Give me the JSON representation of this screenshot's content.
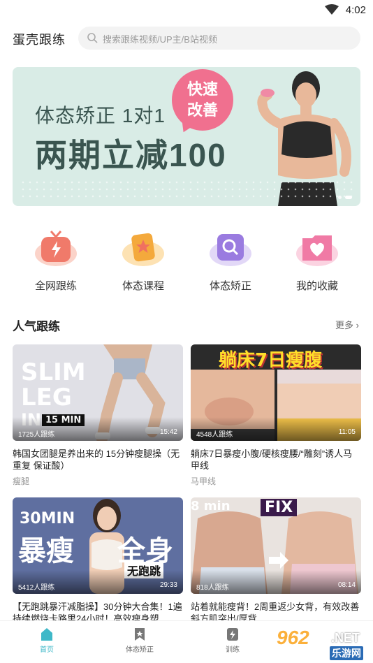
{
  "status_bar": {
    "time": "4:02"
  },
  "header": {
    "app_title": "蛋壳跟练",
    "search_placeholder": "搜索跟练视频/UP主/B站视频"
  },
  "banner": {
    "line1": "体态矫正 1对1",
    "line2": "两期立减100",
    "badge": [
      "快速",
      "改善"
    ]
  },
  "quick_nav": [
    {
      "label": "全网跟练",
      "icon": "lightning-tv-icon",
      "color": "#f07a6a"
    },
    {
      "label": "体态课程",
      "icon": "star-card-icon",
      "color": "#f4a93c"
    },
    {
      "label": "体态矫正",
      "icon": "search-screen-icon",
      "color": "#9a7be0"
    },
    {
      "label": "我的收藏",
      "icon": "heart-folder-icon",
      "color": "#f07aa5"
    }
  ],
  "section": {
    "title": "人气跟练",
    "more": "更多"
  },
  "videos": [
    {
      "title": "韩国女团腿是养出来的 15分钟瘦腿操（无重复 保证酸）",
      "tag": "瘦腿",
      "views": "1725人跟练",
      "duration": "15:42",
      "thumb_text": [
        "SLIM",
        "LEG",
        "IN",
        "15 MIN"
      ]
    },
    {
      "title": "躺床7日暴瘦小腹/硬核瘦腰/“雕刻”诱人马甲线",
      "tag": "马甲线",
      "views": "4548人跟练",
      "duration": "11:05",
      "thumb_text": [
        "躺床7日瘦腹"
      ]
    },
    {
      "title": "【无跑跳暴汗减脂操】30分钟大合集！1遍持续燃烧卡路里24小时！高效瘦身塑",
      "tag": "",
      "views": "5412人跟练",
      "duration": "29:33",
      "thumb_text": [
        "30MIN",
        "暴瘦",
        "全身",
        "无跑跳"
      ]
    },
    {
      "title": "站着就能瘦背！2周重返少女背，有效改善斜方肌突出/厚背",
      "tag": "",
      "views": "818人跟练",
      "duration": "08:14",
      "thumb_text": [
        "8 min",
        "FIX"
      ]
    }
  ],
  "bottom_nav": [
    {
      "label": "首页",
      "icon": "home-icon",
      "active": true
    },
    {
      "label": "体态矫正",
      "icon": "bookmark-icon",
      "active": false
    },
    {
      "label": "训练",
      "icon": "lightning-icon",
      "active": false
    }
  ],
  "watermark": {
    "number": "962",
    "net": ".NET",
    "site": "乐游网"
  },
  "colors": {
    "accent": "#3fb8c8",
    "text": "#222222",
    "muted": "#999999"
  }
}
